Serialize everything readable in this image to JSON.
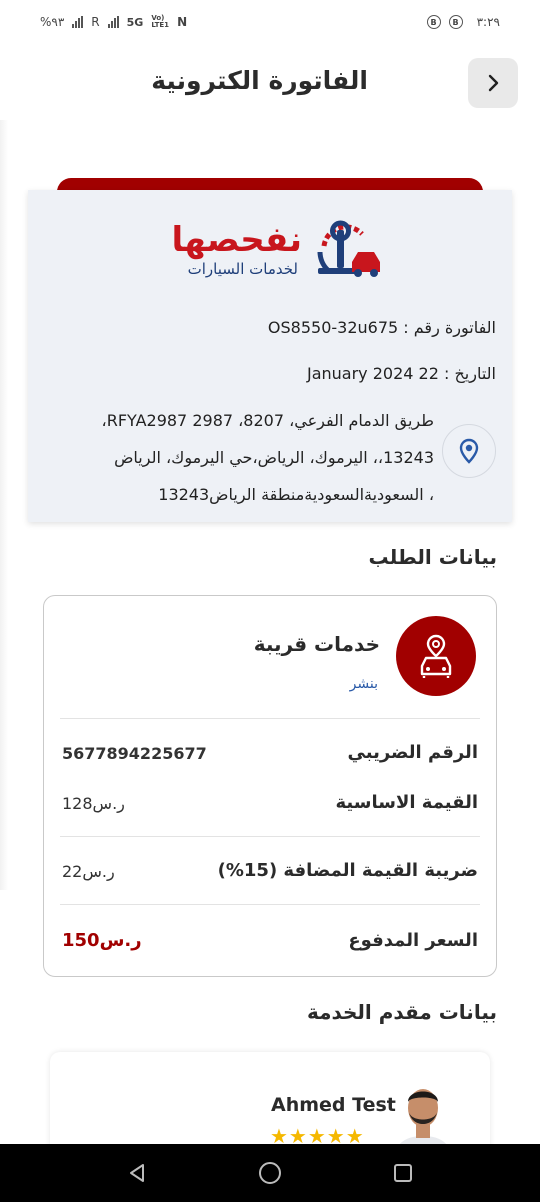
{
  "status_bar": {
    "time": "٣:٢٩",
    "battery": "%٩٣",
    "network_5g": "5G",
    "volte_top": "Vo)",
    "volte_bottom": "LTE1",
    "roaming": "R",
    "nfc": "N",
    "b_badge": "B"
  },
  "header": {
    "title": "الفاتورة الكترونية"
  },
  "logo": {
    "main": "نفحصها",
    "sub": "لخدمات السيارات"
  },
  "invoice": {
    "number_line": "الفاتورة رقم :  OS8550-32u675",
    "date_line": "التاريخ : 22 January 2024",
    "address_line1": "طريق الدمام الفرعي، 8207، 2987 RFYA2987،",
    "address_line2": "13243،، اليرموك، الرياض،حي اليرموك، الرياض",
    "address_line3": "، السعوديةالسعوديةمنطقة الرياض13243"
  },
  "order": {
    "section_title": "بيانات الطلب",
    "service_name": "خدمات قريبة",
    "service_sub": "بنشر",
    "tax_number_label": "الرقم الضريبي",
    "tax_number_value": "5677894225677",
    "base_label": "القيمة الاساسية",
    "base_value": "128ر.س",
    "vat_label": "ضريبة القيمة المضافة (15%)",
    "vat_value": "22ر.س",
    "paid_label": "السعر المدفوع",
    "paid_value": "150ر.س"
  },
  "provider": {
    "section_title": "بيانات مقدم الخدمة",
    "name": "Ahmed Test",
    "stars": "★★★★★",
    "rating": 5
  },
  "colors": {
    "brand_red": "#a10000",
    "brand_blue": "#1f3f7a",
    "star": "#f5b800"
  }
}
